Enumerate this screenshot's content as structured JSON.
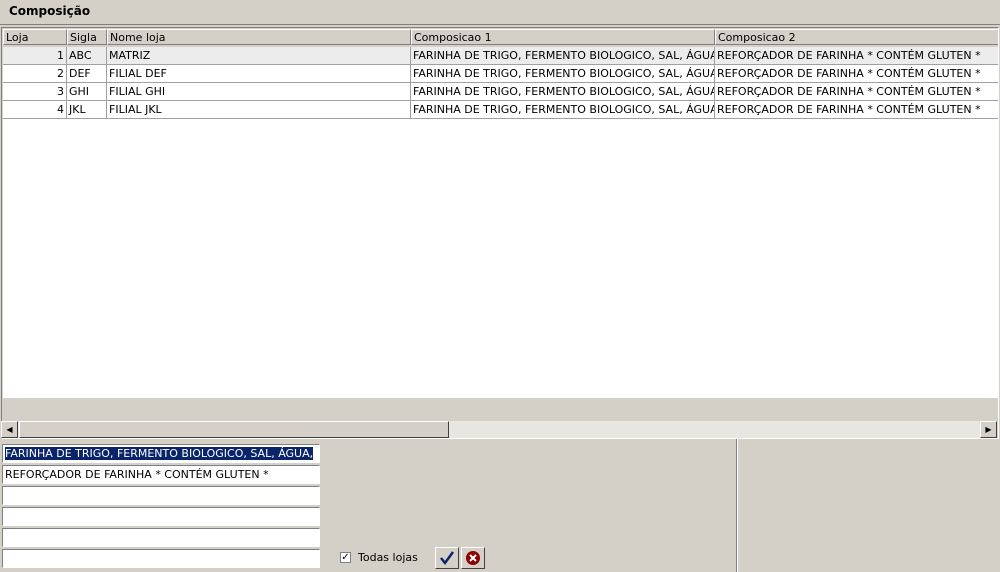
{
  "window": {
    "title": "Composição"
  },
  "grid": {
    "columns": [
      "Loja",
      "Sigla",
      "Nome loja",
      "Composicao 1",
      "Composicao 2"
    ],
    "rows": [
      [
        "1",
        "ABC",
        "MATRIZ",
        "FARINHA DE TRIGO, FERMENTO BIOLOGICO, SAL, ÁGUA,",
        "REFORÇADOR DE FARINHA * CONTÉM GLUTEN *"
      ],
      [
        "2",
        "DEF",
        "FILIAL DEF",
        "FARINHA DE TRIGO, FERMENTO BIOLOGICO, SAL, ÁGUA,",
        "REFORÇADOR DE FARINHA * CONTÉM GLUTEN *"
      ],
      [
        "3",
        "GHI",
        "FILIAL GHI",
        "FARINHA DE TRIGO, FERMENTO BIOLOGICO, SAL, ÁGUA,",
        "REFORÇADOR DE FARINHA * CONTÉM GLUTEN *"
      ],
      [
        "4",
        "JKL",
        "FILIAL JKL",
        "FARINHA DE TRIGO, FERMENTO BIOLOGICO, SAL, ÁGUA,",
        "REFORÇADOR DE FARINHA * CONTÉM GLUTEN *"
      ]
    ],
    "selected_row": 1
  },
  "editor": {
    "lines": [
      "FARINHA DE TRIGO, FERMENTO BIOLOGICO, SAL, ÁGUA,",
      "REFORÇADOR DE FARINHA * CONTÉM GLUTEN *",
      "",
      "",
      "",
      ""
    ],
    "todas_lojas_label": "Todas lojas",
    "todas_lojas_checked": true
  },
  "icons": {
    "confirm": "checkmark-icon",
    "cancel": "cancel-icon",
    "scroll_left": "arrow-left-icon",
    "scroll_right": "arrow-right-icon"
  },
  "colors": {
    "selection_bg": "#0a246a",
    "confirm_icon": "#0a246a",
    "cancel_icon": "#8b0000"
  }
}
